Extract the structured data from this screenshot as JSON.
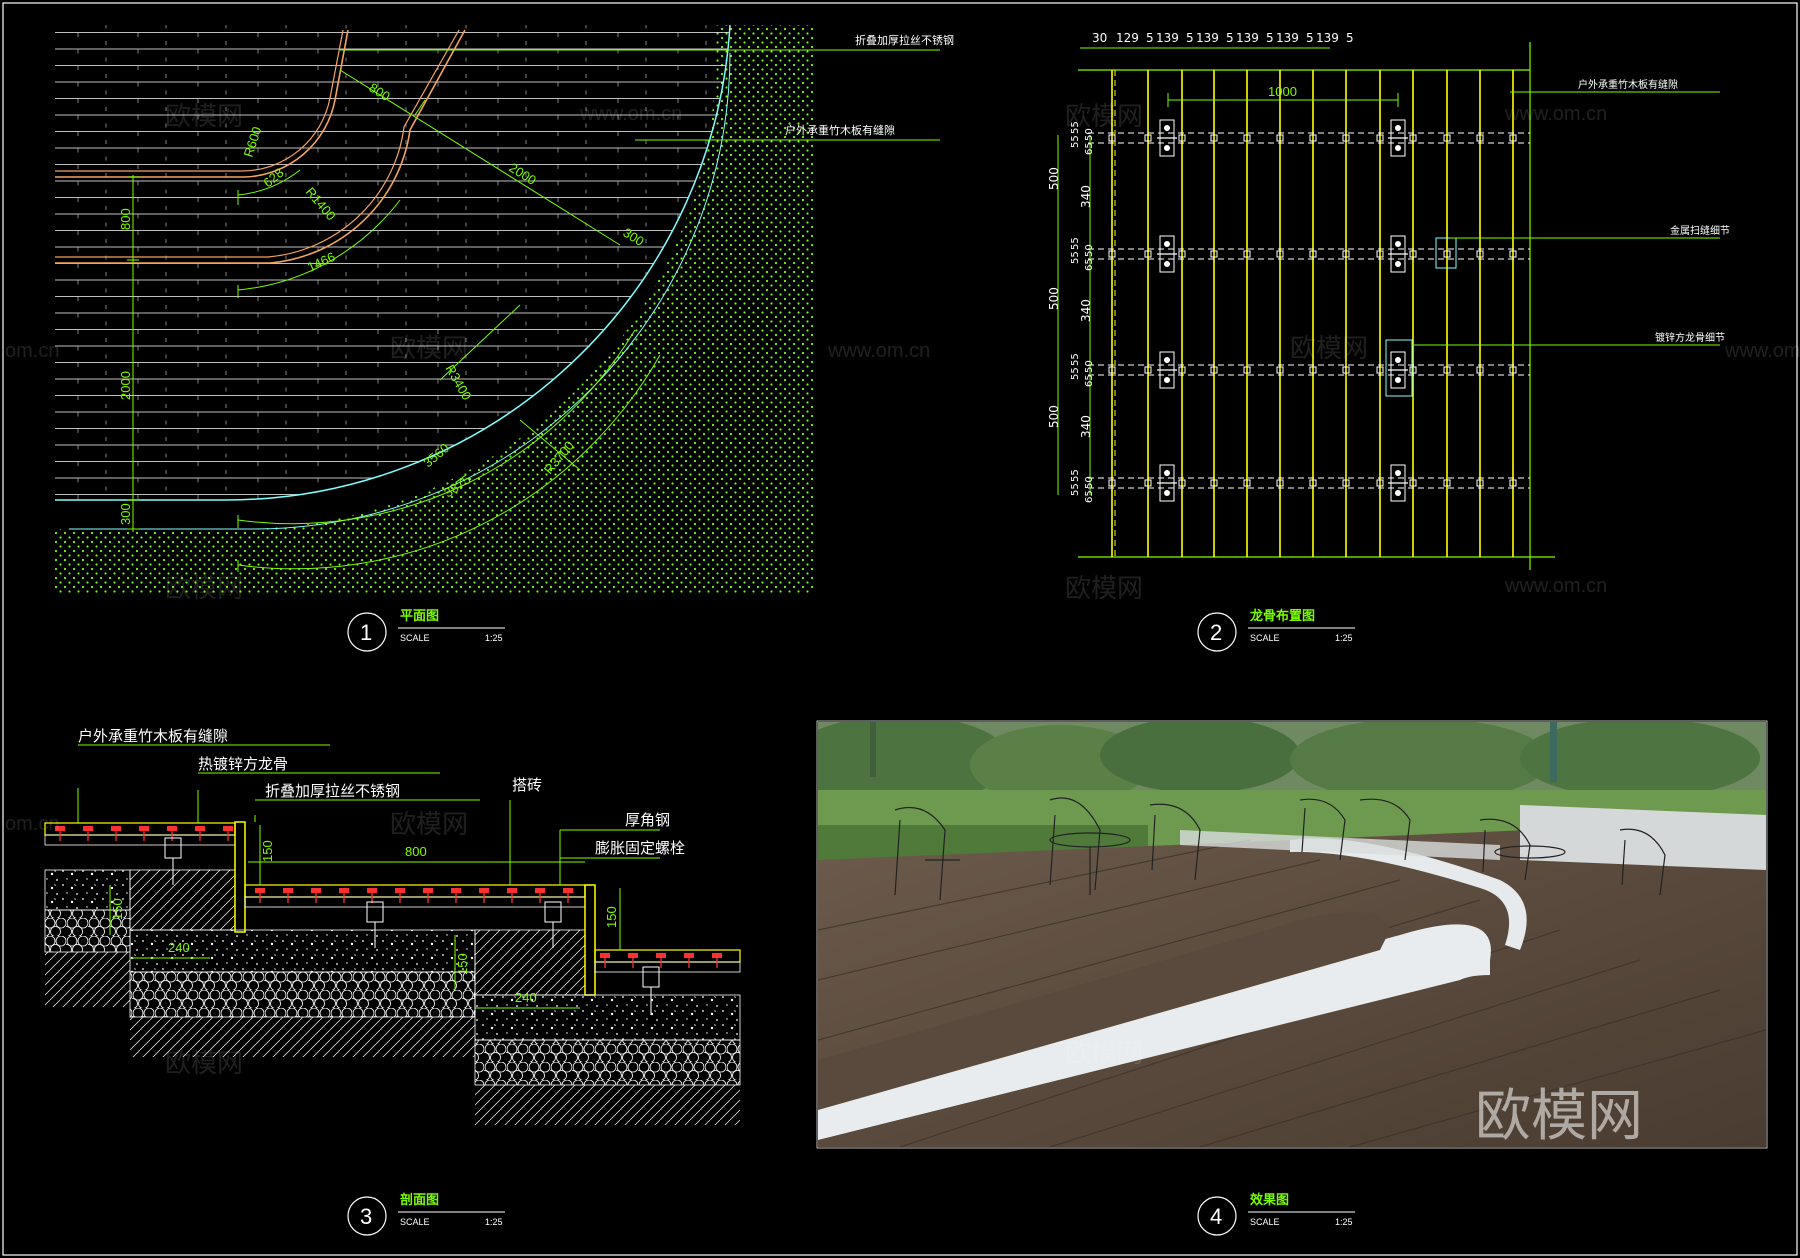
{
  "colors": {
    "background": "#000000",
    "dimension": "#7CFC00",
    "deck_lines": "#ffffff",
    "edge_cyan": "#7fffff",
    "handrail": "#f4a460",
    "joist_yellow": "#ffff00",
    "annotation_red": "#ff3030"
  },
  "panel1": {
    "number": "1",
    "title": "平面图",
    "scale_label": "SCALE",
    "scale_value": "1:25",
    "callouts": [
      "折叠加厚拉丝不锈钢",
      "户外承重竹木板有缝隙"
    ],
    "dims": {
      "d800_top": "800",
      "r600": "R600",
      "d628": "628",
      "r1400": "R1400",
      "d1466": "1466",
      "d2000_diag": "2000",
      "d300_diag": "300",
      "d800_v": "800",
      "d2000_v": "2000",
      "d300_v": "300",
      "r3400": "R3400",
      "d3560": "3560",
      "r3700": "R3700",
      "d3875": "3875"
    }
  },
  "panel2": {
    "number": "2",
    "title": "龙骨布置图",
    "scale_label": "SCALE",
    "scale_value": "1:25",
    "top_dims": [
      "30",
      "129",
      "5",
      "139",
      "5",
      "139",
      "5",
      "139",
      "5",
      "139",
      "5",
      "139",
      "5"
    ],
    "d1000": "1000",
    "left_outer": [
      "500",
      "500",
      "500"
    ],
    "left_inner": [
      "340",
      "340",
      "340"
    ],
    "left_small": [
      "55",
      "50",
      "55",
      "65"
    ],
    "callouts": [
      "户外承重竹木板有缝隙",
      "金属扫缝细节",
      "镀锌方龙骨细节"
    ]
  },
  "panel3": {
    "number": "3",
    "title": "剖面图",
    "scale_label": "SCALE",
    "scale_value": "1:25",
    "callouts": [
      "户外承重竹木板有缝隙",
      "热镀锌方龙骨",
      "折叠加厚拉丝不锈钢",
      "搭砖",
      "厚角钢",
      "膨胀固定螺栓"
    ],
    "dims": {
      "d150_a": "150",
      "d800": "800",
      "d150_b": "150",
      "d240_a": "240",
      "d150_c": "150",
      "d150_d": "150",
      "d240_b": "240"
    }
  },
  "panel4": {
    "number": "4",
    "title": "效果图",
    "scale_label": "SCALE",
    "scale_value": "1:25"
  },
  "watermarks": {
    "cn": "欧模网",
    "url": "www.om.cn",
    "url_partial": "om.cn"
  }
}
